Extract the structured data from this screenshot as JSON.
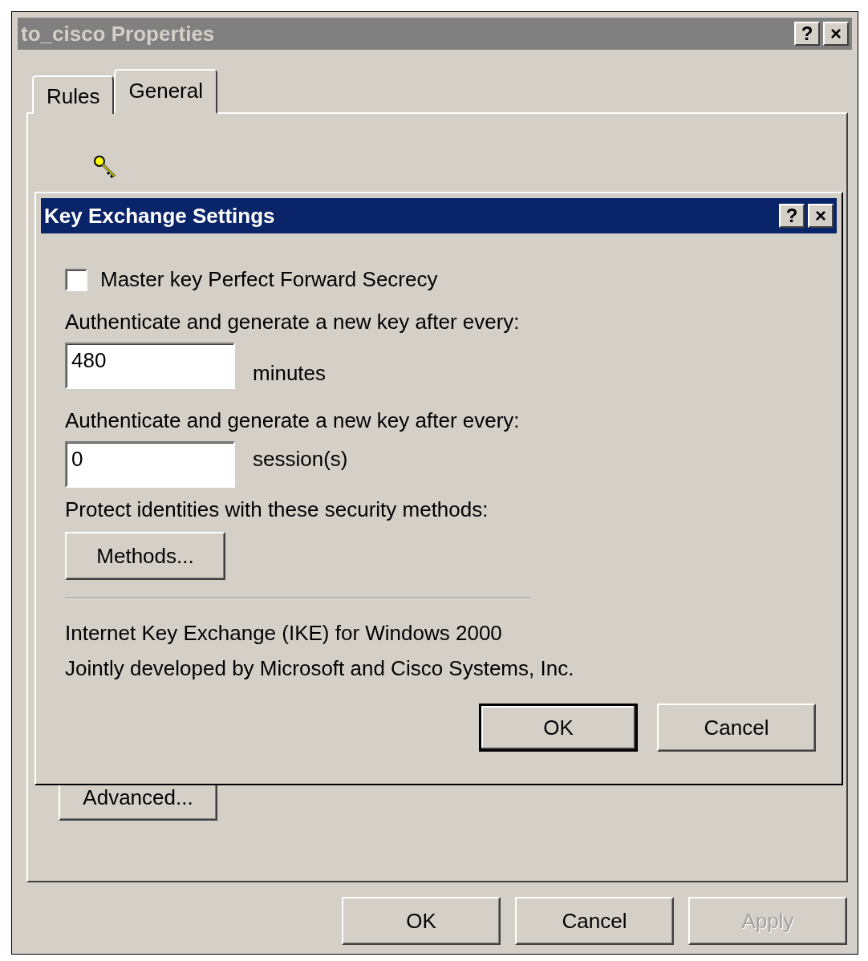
{
  "window": {
    "title": "to_cisco Properties",
    "active": false,
    "help_button": "?",
    "close_button": "×"
  },
  "tabs": [
    {
      "label": "Rules",
      "selected": false
    },
    {
      "label": "General",
      "selected": true
    }
  ],
  "general_tab": {
    "advanced_button": "Advanced..."
  },
  "buttons": [
    {
      "label": "OK",
      "disabled": false
    },
    {
      "label": "Cancel",
      "disabled": false
    },
    {
      "label": "Apply",
      "disabled": true
    }
  ],
  "dialog": {
    "title": "Key Exchange Settings",
    "active": true,
    "help_button": "?",
    "close_button": "×",
    "master_key_pfs": {
      "label": "Master key Perfect Forward Secrecy",
      "checked": false
    },
    "minutes_label": "Authenticate and generate a new key after every:",
    "minutes": {
      "value": "480",
      "unit": "minutes"
    },
    "sessions_label": "Authenticate and generate a new key after every:",
    "sessions": {
      "value": "0",
      "unit": "session(s)"
    },
    "protect_label": "Protect identities with these security methods:",
    "methods_button": "Methods...",
    "info_lines": [
      "Internet Key Exchange (IKE) for Windows 2000",
      "Jointly developed by Microsoft and Cisco Systems, Inc."
    ],
    "buttons": [
      {
        "label": "OK",
        "default": true
      },
      {
        "label": "Cancel",
        "default": false
      }
    ]
  }
}
